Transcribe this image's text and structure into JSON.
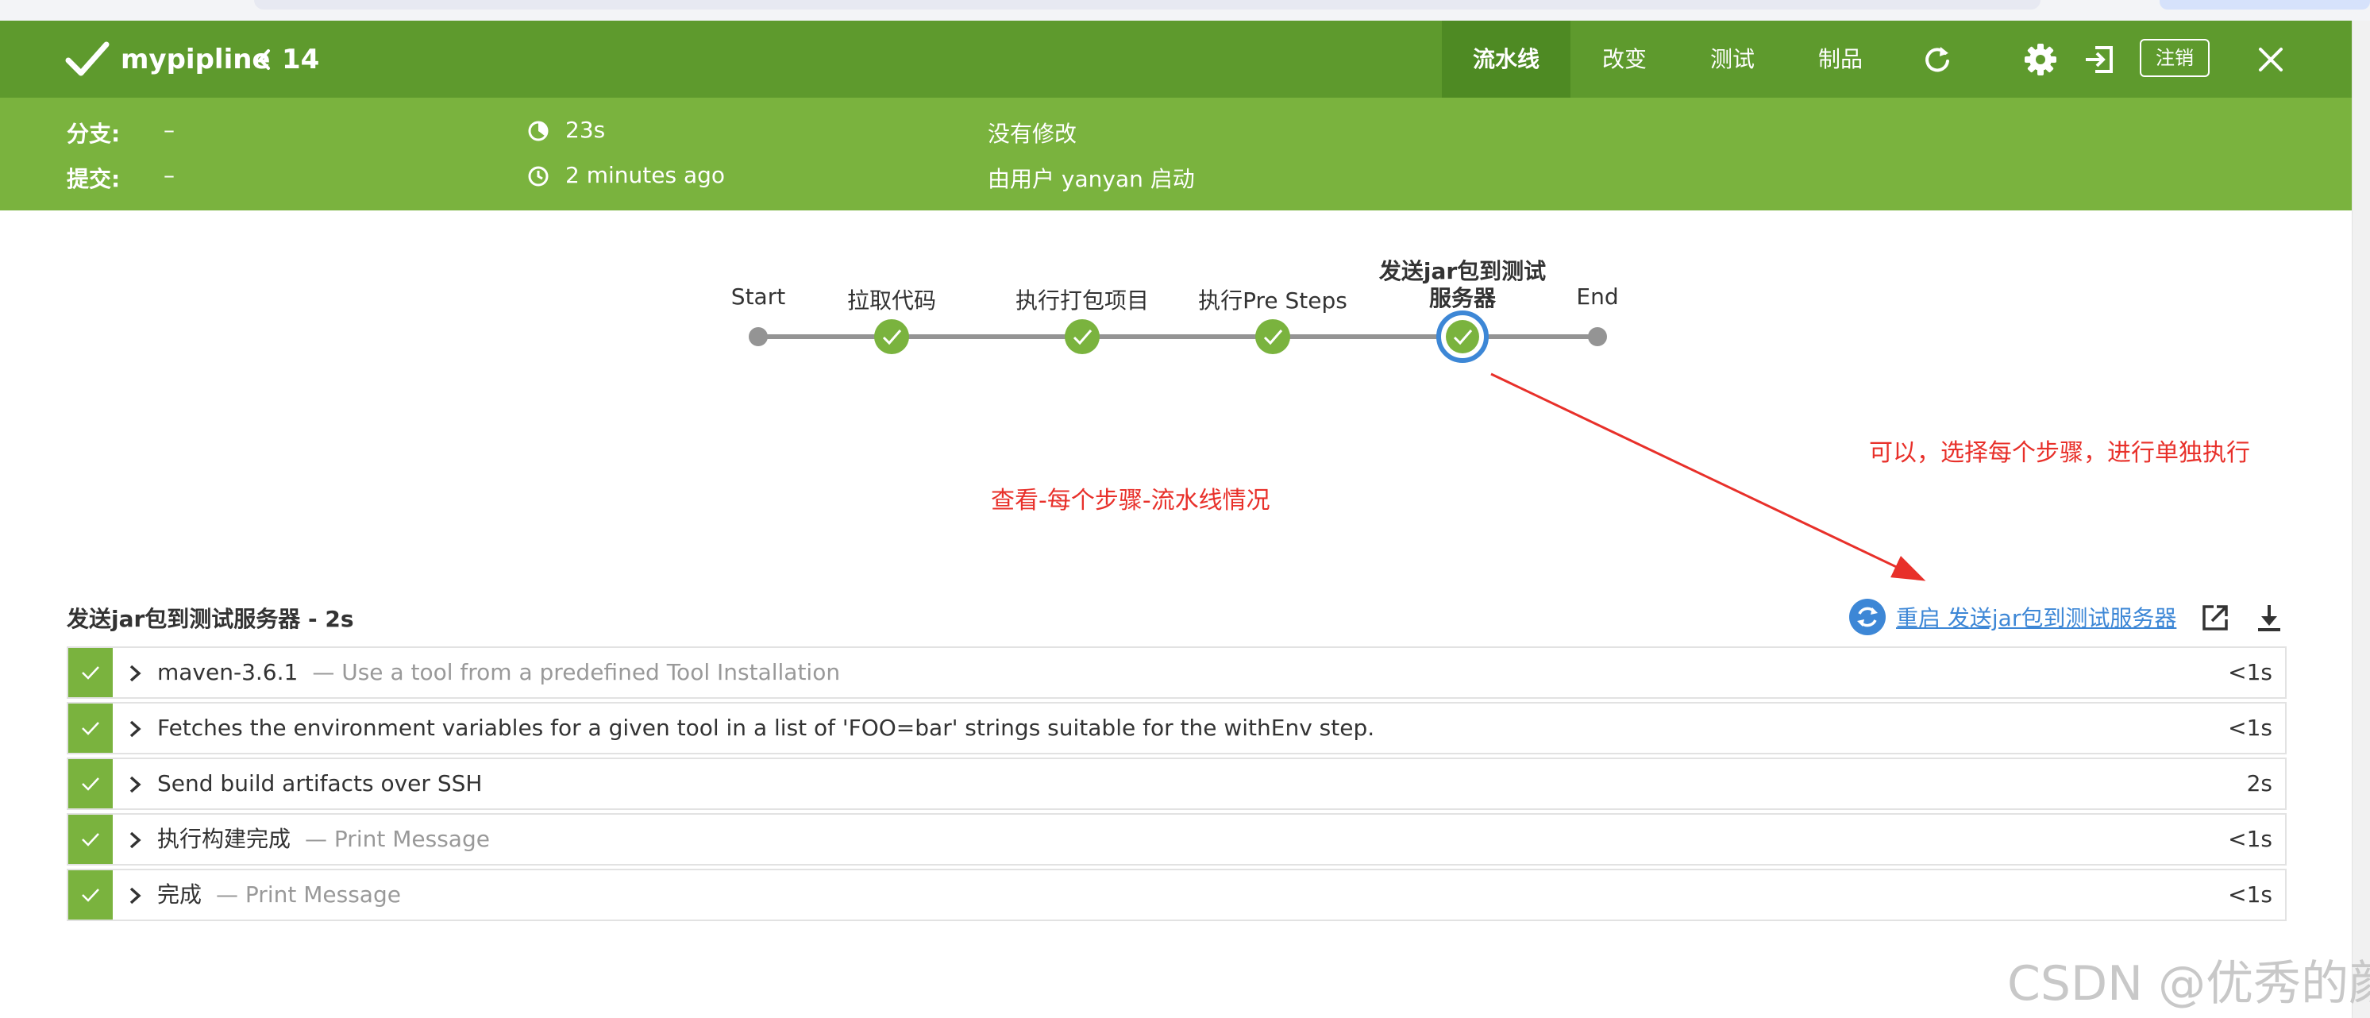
{
  "header": {
    "pipeline_name": "mypipline",
    "run_number": "14",
    "tabs": [
      "流水线",
      "改变",
      "测试",
      "制品"
    ],
    "logout_label": "注销"
  },
  "summary": {
    "branch_label": "分支:",
    "branch_value": "–",
    "commit_label": "提交:",
    "commit_value": "–",
    "duration": "23s",
    "started": "2 minutes ago",
    "changes": "没有修改",
    "started_by": "由用户 yanyan 启动"
  },
  "stages": [
    {
      "label": "Start",
      "status": "node"
    },
    {
      "label": "拉取代码",
      "status": "success"
    },
    {
      "label": "执行打包项目",
      "status": "success"
    },
    {
      "label": "执行Pre Steps",
      "status": "success"
    },
    {
      "label": "发送jar包到测试服务器",
      "status": "success-selected"
    },
    {
      "label": "End",
      "status": "node"
    }
  ],
  "annotations": {
    "left": "查看-每个步骤-流水线情况",
    "right": "可以，选择每个步骤，进行单独执行"
  },
  "steps_panel": {
    "title": "发送jar包到测试服务器 - 2s",
    "restart_link": "重启 发送jar包到测试服务器",
    "steps": [
      {
        "name": "maven-3.6.1",
        "desc": "— Use a tool from a predefined Tool Installation",
        "duration": "<1s"
      },
      {
        "name": "Fetches the environment variables for a given tool in a list of 'FOO=bar' strings suitable for the withEnv step.",
        "desc": "",
        "duration": "<1s"
      },
      {
        "name": "Send build artifacts over SSH",
        "desc": "",
        "duration": "2s"
      },
      {
        "name": "执行构建完成",
        "desc": "— Print Message",
        "duration": "<1s"
      },
      {
        "name": "完成",
        "desc": "— Print Message",
        "duration": "<1s"
      }
    ]
  },
  "watermark": "CSDN @优秀的颜",
  "colors": {
    "header_bg": "#5e9a2d",
    "summary_bg": "#7ab33e",
    "success": "#7ab33e",
    "selected_ring": "#3d87d6",
    "annotation": "#e8302a",
    "link": "#3d87d6"
  }
}
